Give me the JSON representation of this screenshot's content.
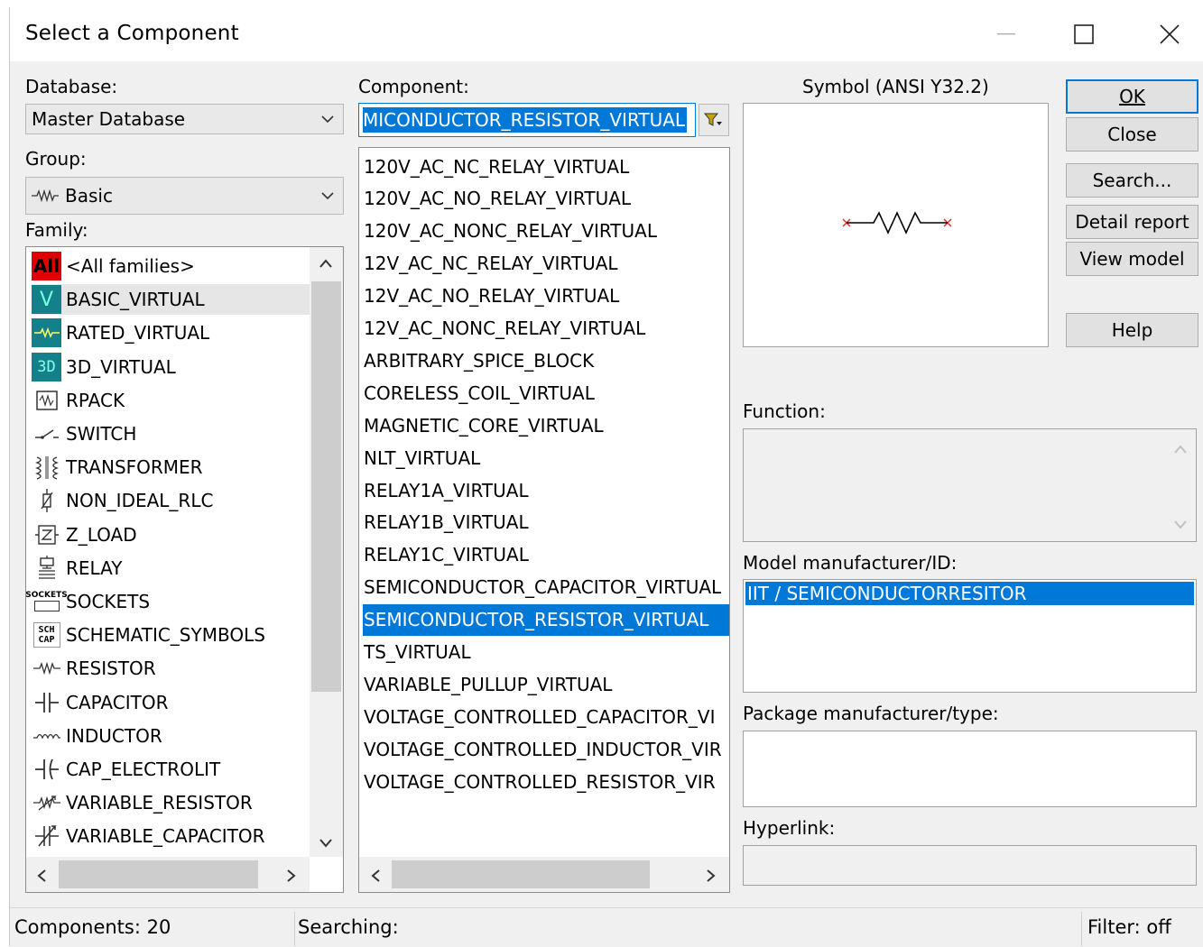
{
  "window": {
    "title": "Select a Component"
  },
  "database": {
    "label": "Database:",
    "value": "Master Database"
  },
  "group": {
    "label": "Group:",
    "value": "Basic",
    "icon": "resistor-wave-icon"
  },
  "family": {
    "label": "Family:",
    "items": [
      {
        "label": "<All families>",
        "icon": "all-icon"
      },
      {
        "label": "BASIC_VIRTUAL",
        "icon": "virtual-icon",
        "selected": true
      },
      {
        "label": "RATED_VIRTUAL",
        "icon": "rated-virtual-icon"
      },
      {
        "label": "3D_VIRTUAL",
        "icon": "3d-icon"
      },
      {
        "label": "RPACK",
        "icon": "rpack-icon"
      },
      {
        "label": "SWITCH",
        "icon": "switch-icon"
      },
      {
        "label": "TRANSFORMER",
        "icon": "transformer-icon"
      },
      {
        "label": "NON_IDEAL_RLC",
        "icon": "non-ideal-rlc-icon"
      },
      {
        "label": "Z_LOAD",
        "icon": "z-load-icon"
      },
      {
        "label": "RELAY",
        "icon": "relay-icon"
      },
      {
        "label": "SOCKETS",
        "icon": "sockets-icon"
      },
      {
        "label": "SCHEMATIC_SYMBOLS",
        "icon": "schematic-symbols-icon"
      },
      {
        "label": "RESISTOR",
        "icon": "resistor-icon"
      },
      {
        "label": "CAPACITOR",
        "icon": "capacitor-icon"
      },
      {
        "label": "INDUCTOR",
        "icon": "inductor-icon"
      },
      {
        "label": "CAP_ELECTROLIT",
        "icon": "cap-electrolit-icon"
      },
      {
        "label": "VARIABLE_RESISTOR",
        "icon": "variable-resistor-icon"
      },
      {
        "label": "VARIABLE_CAPACITOR",
        "icon": "variable-capacitor-icon"
      }
    ]
  },
  "component": {
    "label": "Component:",
    "search_value": "MICONDUCTOR_RESISTOR_VIRTUAL",
    "items": [
      "120V_AC_NC_RELAY_VIRTUAL",
      "120V_AC_NO_RELAY_VIRTUAL",
      "120V_AC_NONC_RELAY_VIRTUAL",
      "12V_AC_NC_RELAY_VIRTUAL",
      "12V_AC_NO_RELAY_VIRTUAL",
      "12V_AC_NONC_RELAY_VIRTUAL",
      "ARBITRARY_SPICE_BLOCK",
      "CORELESS_COIL_VIRTUAL",
      "MAGNETIC_CORE_VIRTUAL",
      "NLT_VIRTUAL",
      "RELAY1A_VIRTUAL",
      "RELAY1B_VIRTUAL",
      "RELAY1C_VIRTUAL",
      "SEMICONDUCTOR_CAPACITOR_VIRTUAL",
      "SEMICONDUCTOR_RESISTOR_VIRTUAL",
      "TS_VIRTUAL",
      "VARIABLE_PULLUP_VIRTUAL",
      "VOLTAGE_CONTROLLED_CAPACITOR_VI",
      "VOLTAGE_CONTROLLED_INDUCTOR_VIR",
      "VOLTAGE_CONTROLLED_RESISTOR_VIR"
    ],
    "selected_index": 14
  },
  "symbol": {
    "label": "Symbol (ANSI Y32.2)"
  },
  "buttons": {
    "ok": "OK",
    "close": "Close",
    "search": "Search...",
    "detail_report": "Detail report",
    "view_model": "View model",
    "help": "Help"
  },
  "function": {
    "label": "Function:",
    "value": ""
  },
  "model": {
    "label": "Model manufacturer/ID:",
    "value": "IIT / SEMICONDUCTORRESITOR"
  },
  "package": {
    "label": "Package manufacturer/type:"
  },
  "hyperlink": {
    "label": "Hyperlink:"
  },
  "status": {
    "components": "Components: 20",
    "searching": "Searching:",
    "filter": "Filter: off"
  },
  "colors": {
    "accent": "#0078d7",
    "all_icon_bg": "#e00000",
    "teal": "#14808a"
  }
}
